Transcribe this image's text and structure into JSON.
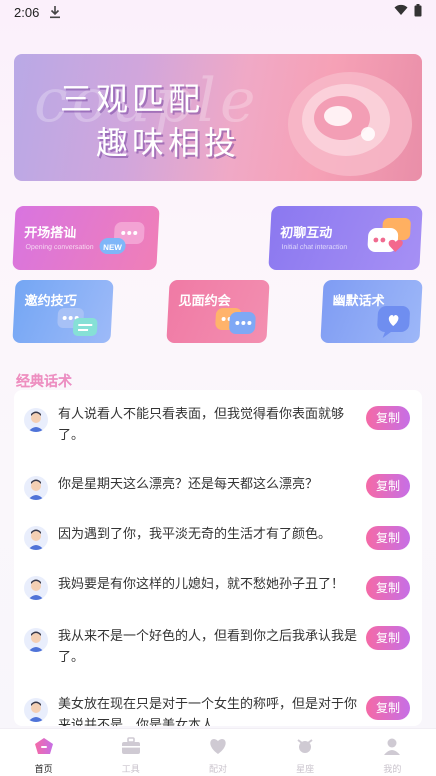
{
  "status_bar": {
    "time": "2:06"
  },
  "banner": {
    "line1": "三观匹配",
    "line2": "趣味相投",
    "script_text": "couple"
  },
  "features": [
    {
      "title": "开场搭讪",
      "subtitle": "Opening conversation",
      "badge": "NEW"
    },
    {
      "title": "初聊互动",
      "subtitle": "Initial chat interaction"
    },
    {
      "title": "邀约技巧"
    },
    {
      "title": "见面约会"
    },
    {
      "title": "幽默话术"
    }
  ],
  "section": {
    "title": "经典话术"
  },
  "phrases": [
    {
      "text": "有人说看人不能只看表面，但我觉得看你表面就够了。",
      "copy_label": "复制"
    },
    {
      "text": "你是星期天这么漂亮？还是每天都这么漂亮？",
      "copy_label": "复制"
    },
    {
      "text": "因为遇到了你，我平淡无奇的生活才有了颜色。",
      "copy_label": "复制"
    },
    {
      "text": "我妈要是有你这样的儿媳妇，就不愁她孙子丑了！",
      "copy_label": "复制"
    },
    {
      "text": "我从来不是一个好色的人，但看到你之后我承认我是了。",
      "copy_label": "复制"
    },
    {
      "text": "美女放在现在只是对于一个女生的称呼，但是对于你来说并不是，你是美女本人",
      "copy_label": "复制"
    }
  ],
  "tabs": [
    {
      "label": "首页",
      "icon": "home-icon",
      "active": true
    },
    {
      "label": "工具",
      "icon": "toolbox-icon"
    },
    {
      "label": "配对",
      "icon": "heart-icon"
    },
    {
      "label": "星座",
      "icon": "star-sign-icon"
    },
    {
      "label": "我的",
      "icon": "profile-icon"
    }
  ],
  "colors": {
    "accent_pink": "#f56aa6",
    "accent_purple": "#c66fe6"
  }
}
